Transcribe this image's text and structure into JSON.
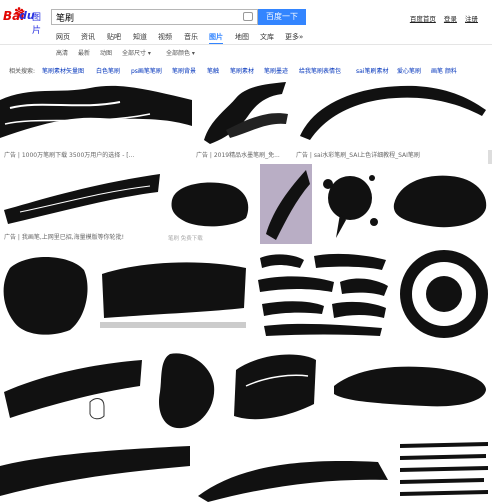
{
  "logo": {
    "brand_bai": "Bai",
    "brand_du": "du",
    "product": "图片",
    "paw": "✽"
  },
  "search": {
    "query": "笔刷",
    "button": "百度一下"
  },
  "toplinks": [
    "百度首页",
    "登录",
    "注册"
  ],
  "nav": [
    {
      "label": "网页"
    },
    {
      "label": "资讯"
    },
    {
      "label": "贴吧"
    },
    {
      "label": "知道"
    },
    {
      "label": "视频"
    },
    {
      "label": "音乐"
    },
    {
      "label": "图片",
      "active": true
    },
    {
      "label": "地图"
    },
    {
      "label": "文库"
    },
    {
      "label": "更多»"
    }
  ],
  "filters": [
    "高清",
    "最新",
    "动图",
    "全部尺寸 ▾",
    "全部颜色 ▾"
  ],
  "related": {
    "label": "相关搜索:",
    "items": [
      "笔刷素材矢量图",
      "白色笔刷",
      "ps画笔笔刷",
      "笔刷背景",
      "笔触",
      "笔刷素材",
      "笔刷墨迹",
      "给我笔刷表情包",
      "sai笔刷素材",
      "爱心笔刷",
      "画笔 颜料"
    ]
  },
  "captions": [
    "广告 | 1000万笔刷下载 3500万用户的选择 - [...",
    "广告 | 2019精品水墨笔刷_免...",
    "广告 | sai水彩笔刷_SAI上色详细教程_SAI笔刷",
    "广告 | 我画笔,上网里已招,海量模版等你轮批!"
  ],
  "overlay_text": "笔刷 免费下载",
  "colors": {
    "accent": "#3385ff",
    "logo_red": "#e10602",
    "logo_blue": "#2932e1",
    "link": "#0033bb"
  }
}
